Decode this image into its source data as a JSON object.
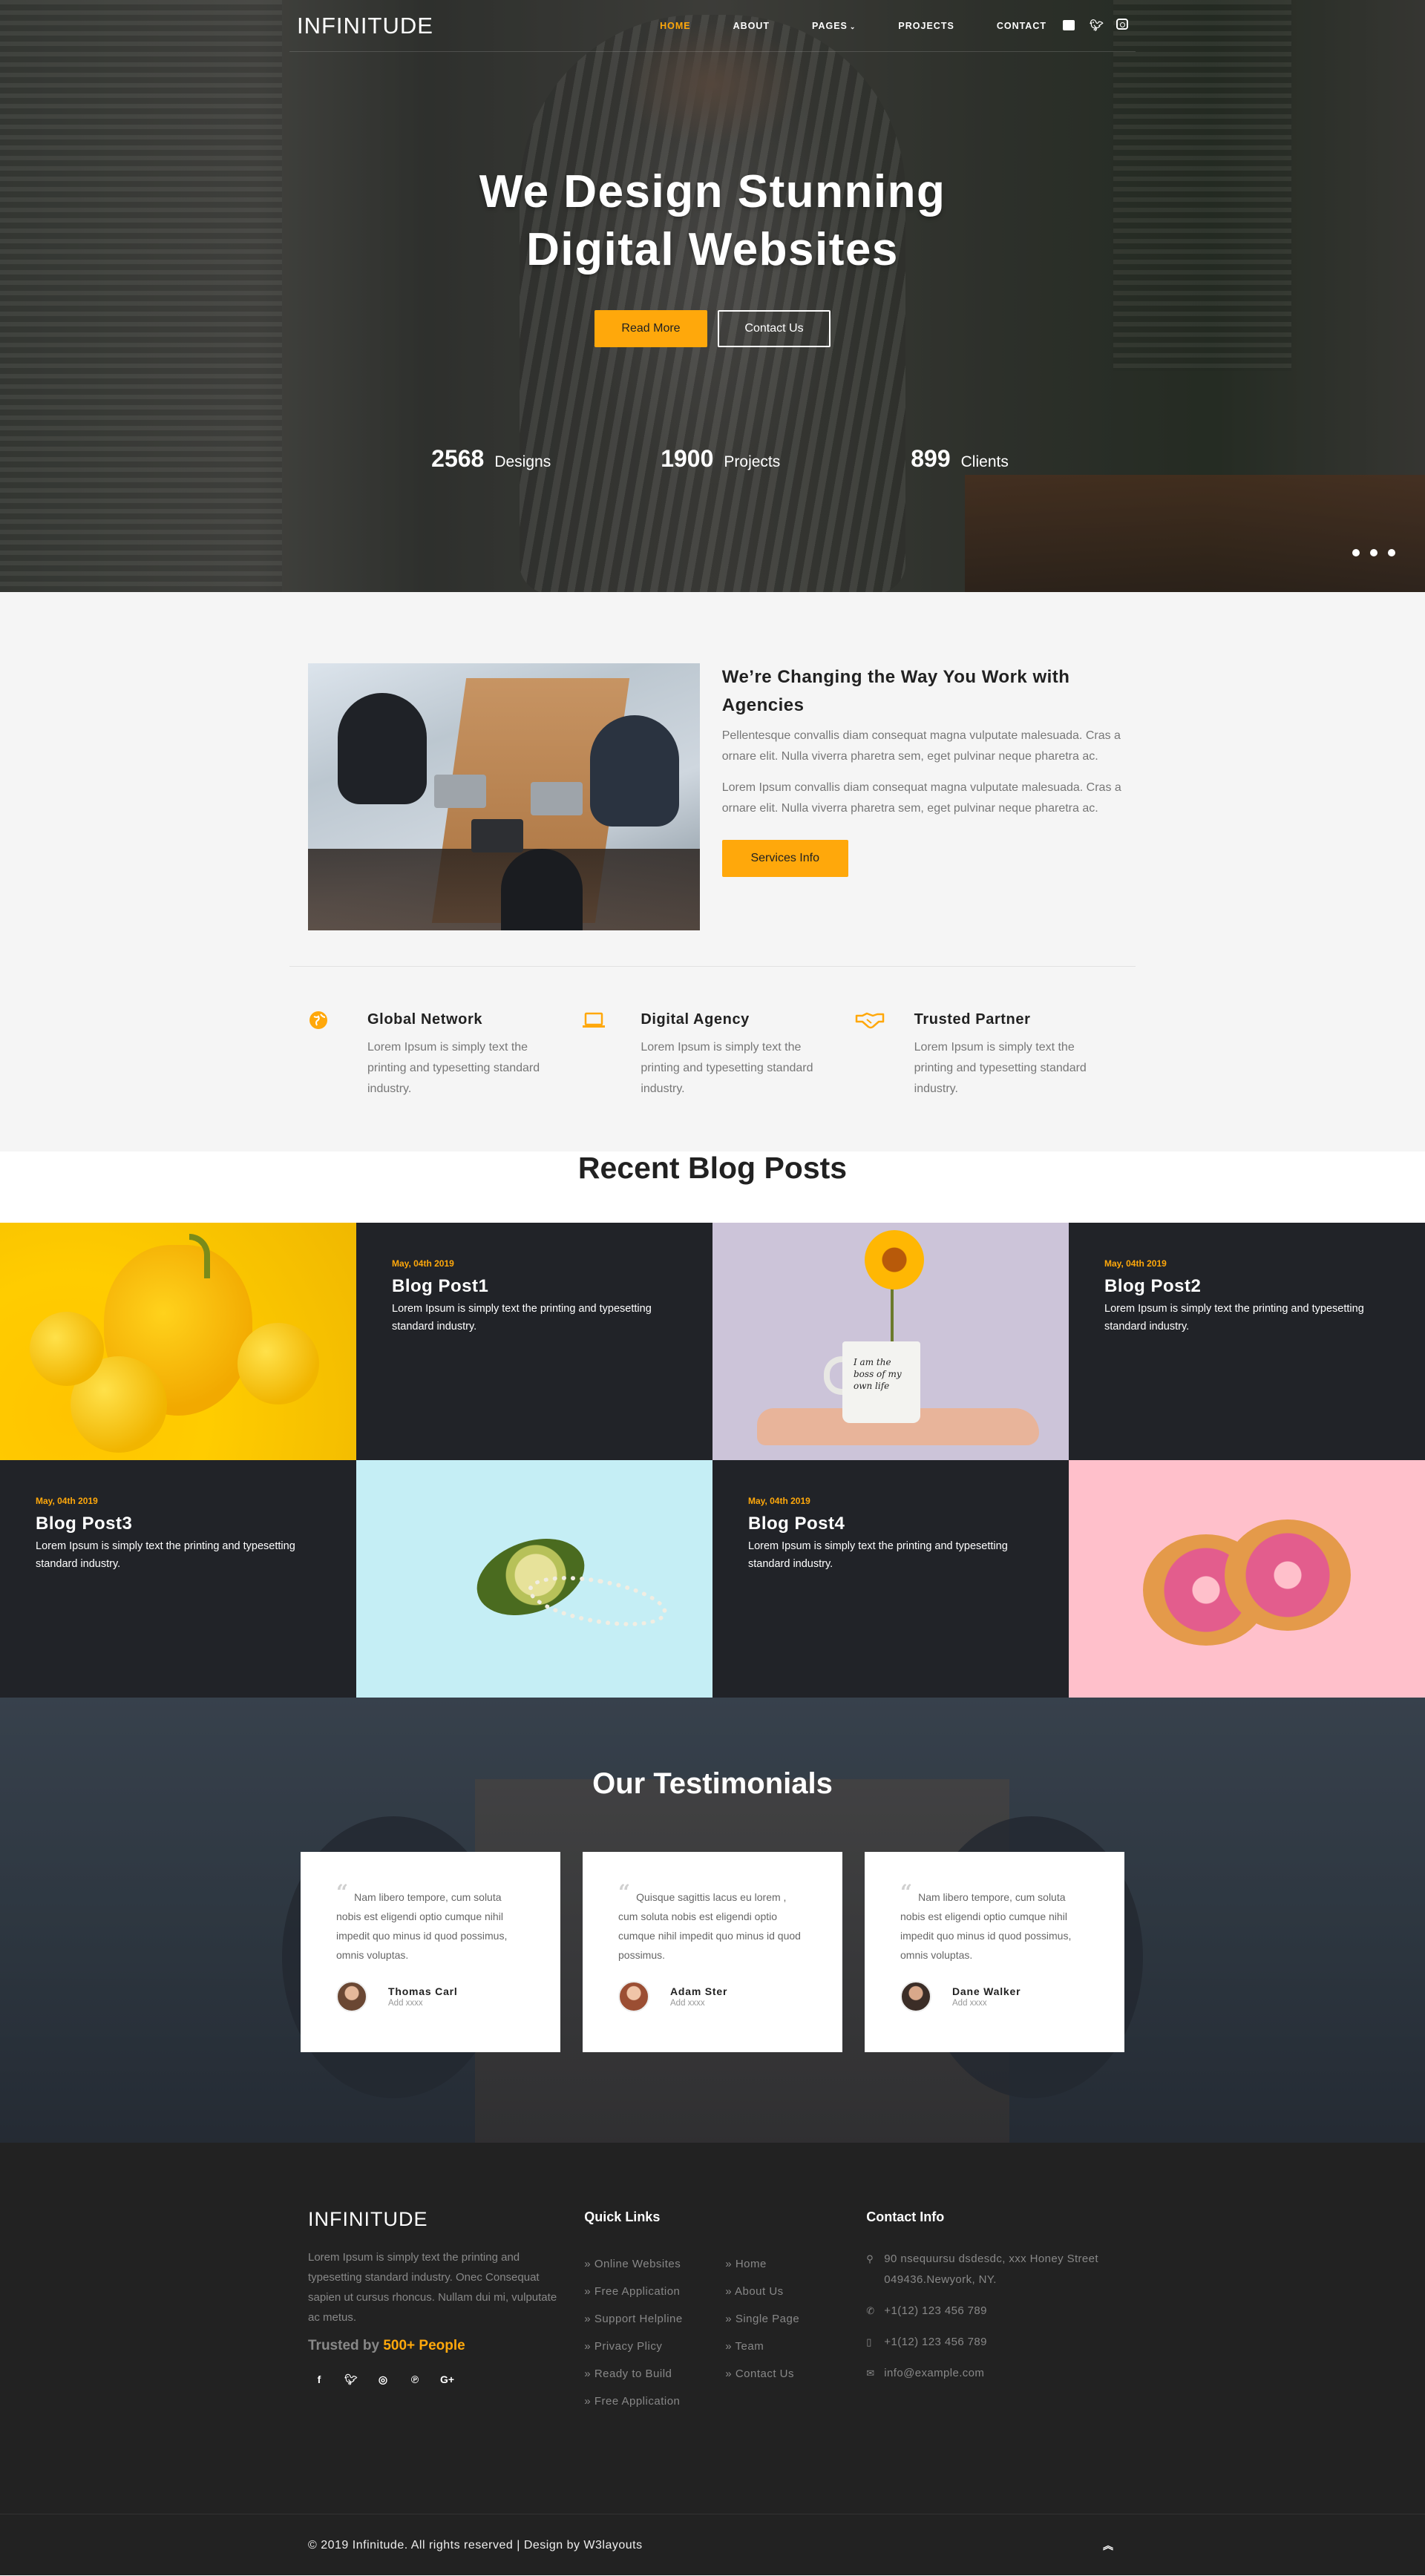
{
  "header": {
    "logo": "INFINITUDE",
    "menu": [
      {
        "label": "HOME",
        "active": true
      },
      {
        "label": "ABOUT",
        "active": false
      },
      {
        "label": "PAGES",
        "active": false,
        "has_dropdown": true
      },
      {
        "label": "PROJECTS",
        "active": false
      },
      {
        "label": "CONTACT",
        "active": false
      }
    ],
    "social_icons": [
      "facebook-icon",
      "twitter-icon",
      "instagram-icon"
    ]
  },
  "hero": {
    "title_line1": "We Design Stunning",
    "title_line2": "Digital Websites",
    "read_more": "Read More",
    "contact_us": "Contact Us",
    "stats": [
      {
        "value": "2568",
        "label": "Designs"
      },
      {
        "value": "1900",
        "label": "Projects"
      },
      {
        "value": "899",
        "label": "Clients"
      }
    ],
    "slider_dots": 3
  },
  "about": {
    "heading": "We’re Changing the Way You Work with Agencies",
    "para1": "Pellentesque convallis diam consequat magna vulputate malesuada. Cras a ornare elit. Nulla viverra pharetra sem, eget pulvinar neque pharetra ac.",
    "para2": "Lorem Ipsum convallis diam consequat magna vulputate malesuada. Cras a ornare elit. Nulla viverra pharetra sem, eget pulvinar neque pharetra ac.",
    "button": "Services Info",
    "features": [
      {
        "icon": "globe-icon",
        "title": "Global Network",
        "text": "Lorem Ipsum is simply text the printing and typesetting standard industry."
      },
      {
        "icon": "laptop-icon",
        "title": "Digital Agency",
        "text": "Lorem Ipsum is simply text the printing and typesetting standard industry."
      },
      {
        "icon": "handshake-icon",
        "title": "Trusted Partner",
        "text": "Lorem Ipsum is simply text the printing and typesetting standard industry."
      }
    ]
  },
  "blog": {
    "heading": "Recent Blog Posts",
    "posts": [
      {
        "date": "May, 04th 2019",
        "title": "Blog Post1",
        "text": "Lorem Ipsum is simply text the printing and typesetting standard industry."
      },
      {
        "date": "May, 04th 2019",
        "title": "Blog Post2",
        "text": "Lorem Ipsum is simply text the printing and typesetting standard industry."
      },
      {
        "date": "May, 04th 2019",
        "title": "Blog Post3",
        "text": "Lorem Ipsum is simply text the printing and typesetting standard industry."
      },
      {
        "date": "May, 04th 2019",
        "title": "Blog Post4",
        "text": "Lorem Ipsum is simply text the printing and typesetting standard industry."
      }
    ],
    "mug_text": "I am the boss of my own life"
  },
  "testimonials": {
    "heading": "Our Testimonials",
    "items": [
      {
        "quote": "Nam libero tempore, cum soluta nobis est eligendi optio cumque nihil impedit quo minus id quod possimus, omnis voluptas.",
        "name": "Thomas Carl",
        "role": "Add xxxx"
      },
      {
        "quote": "Quisque sagittis lacus eu lorem , cum soluta nobis est eligendi optio cumque nihil impedit quo minus id quod possimus.",
        "name": "Adam Ster",
        "role": "Add xxxx"
      },
      {
        "quote": "Nam libero tempore, cum soluta nobis est eligendi optio cumque nihil impedit quo minus id quod possimus, omnis voluptas.",
        "name": "Dane Walker",
        "role": "Add xxxx"
      }
    ]
  },
  "footer": {
    "logo": "INFINITUDE",
    "description": "Lorem Ipsum is simply text the printing and typesetting standard industry. Onec Consequat sapien ut cursus rhoncus. Nullam dui mi, vulputate ac metus.",
    "trusted_prefix": "Trusted by",
    "trusted_highlight": "500+ People",
    "social_icons": [
      "facebook-icon",
      "twitter-icon",
      "dribbble-icon",
      "pinterest-icon",
      "google-plus-icon"
    ],
    "quick_links_title": "Quick Links",
    "quick_links_col1": [
      "Online Websites",
      "Free Application",
      "Support Helpline",
      "Privacy Plicy",
      "Ready to Build",
      "Free Application"
    ],
    "quick_links_col2": [
      "Home",
      "About Us",
      "Single Page",
      "Team",
      "Contact Us"
    ],
    "contact_title": "Contact Info",
    "address": "90 nsequursu dsdesdc, xxx Honey Street 049436.Newyork, NY.",
    "phone1": "+1(12) 123 456 789",
    "phone2": "+1(12) 123 456 789",
    "email": "info@example.com",
    "copyright": "© 2019 Infinitude. All rights reserved | Design by W3layouts"
  },
  "colors": {
    "accent": "#ffa80b",
    "dark": "#212328",
    "footer": "#222222"
  }
}
